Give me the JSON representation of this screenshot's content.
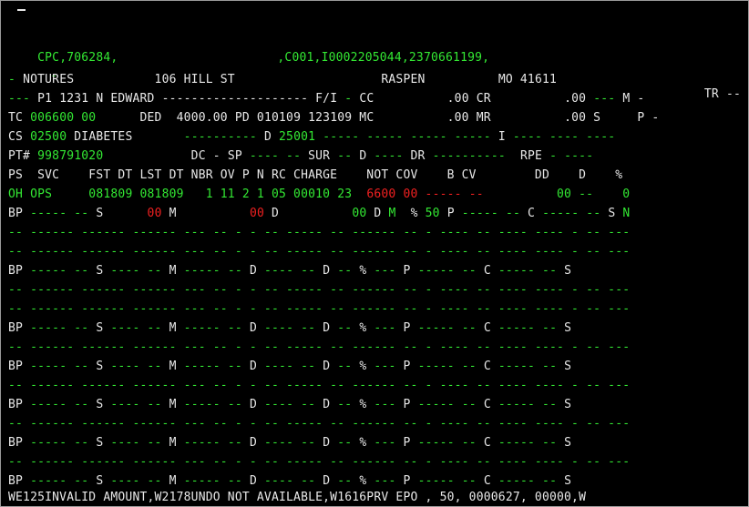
{
  "header": {
    "line1_left": "CPC,706284,",
    "line1_right": ",C001,I0002205044,2370661199,",
    "line2_dash": "-",
    "line2_tr": "TR --"
  },
  "patient": {
    "row1": [
      {
        "t": "- ",
        "c": "g"
      },
      {
        "t": "NOTURES",
        "c": "w"
      },
      {
        "t": "           106 HILL ST",
        "c": "w"
      },
      {
        "t": "                    RASPEN",
        "c": "w"
      },
      {
        "t": "          MO 41611",
        "c": "w"
      }
    ],
    "row2": [
      {
        "t": "--- ",
        "c": "g"
      },
      {
        "t": "P1 1231 N EDWARD ",
        "c": "w"
      },
      {
        "t": "-------------------- ",
        "c": "w"
      },
      {
        "t": "F/I",
        "c": "w"
      },
      {
        "t": " - ",
        "c": "g"
      },
      {
        "t": "CC",
        "c": "w"
      },
      {
        "t": "          .00 CR",
        "c": "w"
      },
      {
        "t": "          .00 ",
        "c": "w"
      },
      {
        "t": "--- ",
        "c": "g"
      },
      {
        "t": "M -",
        "c": "w"
      }
    ],
    "row3": [
      {
        "t": "TC ",
        "c": "w"
      },
      {
        "t": "006600 00",
        "c": "g"
      },
      {
        "t": "      DED  4000.00 PD 010109 123109 MC",
        "c": "w"
      },
      {
        "t": "          .00 MR",
        "c": "w"
      },
      {
        "t": "          .00 S     P -",
        "c": "w"
      }
    ],
    "row4": [
      {
        "t": "CS ",
        "c": "w"
      },
      {
        "t": "02500",
        "c": "g"
      },
      {
        "t": " DIABETES",
        "c": "w"
      },
      {
        "t": "       ---------- ",
        "c": "g"
      },
      {
        "t": "D ",
        "c": "w"
      },
      {
        "t": "25001",
        "c": "g"
      },
      {
        "t": " ----- ----- ----- ----- ",
        "c": "g"
      },
      {
        "t": "I",
        "c": "w"
      },
      {
        "t": " ---- ---- ----",
        "c": "g"
      }
    ],
    "row5": [
      {
        "t": "PT# ",
        "c": "w"
      },
      {
        "t": "998791020",
        "c": "g"
      },
      {
        "t": "            DC - SP ",
        "c": "w"
      },
      {
        "t": "---- -- ",
        "c": "g"
      },
      {
        "t": "SUR",
        "c": "w"
      },
      {
        "t": " -- ",
        "c": "g"
      },
      {
        "t": "D",
        "c": "w"
      },
      {
        "t": " ---- ",
        "c": "g"
      },
      {
        "t": "DR",
        "c": "w"
      },
      {
        "t": " ----------  ",
        "c": "g"
      },
      {
        "t": "RPE",
        "c": "w"
      },
      {
        "t": " - ----",
        "c": "g"
      }
    ]
  },
  "columns": {
    "header_row": "PS  SVC    FST DT LST DT NBR OV P N RC CHARGE    NOT COV    B CV        DD    D    %",
    "first_line": [
      {
        "t": "OH OPS",
        "c": "g"
      },
      {
        "t": "     081809 081809   1 11 2 1 05 00010 23  ",
        "c": "g"
      },
      {
        "t": "6600 00",
        "c": "r"
      },
      {
        "t": " ----- --",
        "c": "r"
      },
      {
        "t": "          00 --    0",
        "c": "g"
      }
    ]
  },
  "bp_first": [
    {
      "t": "BP",
      "c": "w"
    },
    {
      "t": " ----- -- ",
      "c": "g"
    },
    {
      "t": "S",
      "c": "w"
    },
    {
      "t": "      ",
      "c": "g"
    },
    {
      "t": "00",
      "c": "r"
    },
    {
      "t": " M",
      "c": "w"
    },
    {
      "t": "          ",
      "c": "g"
    },
    {
      "t": "00",
      "c": "r"
    },
    {
      "t": " D",
      "c": "w"
    },
    {
      "t": "          00",
      "c": "g"
    },
    {
      "t": " D ",
      "c": "w"
    },
    {
      "t": "M",
      "c": "g"
    },
    {
      "t": "  % ",
      "c": "w"
    },
    {
      "t": "50",
      "c": "g"
    },
    {
      "t": " P",
      "c": "w"
    },
    {
      "t": " ----- -- ",
      "c": "g"
    },
    {
      "t": "C",
      "c": "w"
    },
    {
      "t": " ----- -- ",
      "c": "g"
    },
    {
      "t": "S ",
      "c": "w"
    },
    {
      "t": "N",
      "c": "g"
    }
  ],
  "dash_row": "-- ------ ------ ------ --- -- - - -- ----- -- ------ -- - ---- -- ---- ---- - -- ---",
  "bp_empty": [
    {
      "t": "BP",
      "c": "w"
    },
    {
      "t": " ----- -- ",
      "c": "g"
    },
    {
      "t": "S",
      "c": "w"
    },
    {
      "t": " ---- -- ",
      "c": "g"
    },
    {
      "t": "M",
      "c": "w"
    },
    {
      "t": " ----- -- ",
      "c": "g"
    },
    {
      "t": "D",
      "c": "w"
    },
    {
      "t": " ---- -- ",
      "c": "g"
    },
    {
      "t": "D",
      "c": "w"
    },
    {
      "t": " -- ",
      "c": "g"
    },
    {
      "t": "%",
      "c": "w"
    },
    {
      "t": " --- ",
      "c": "g"
    },
    {
      "t": "P",
      "c": "w"
    },
    {
      "t": " ----- -- ",
      "c": "g"
    },
    {
      "t": "C",
      "c": "w"
    },
    {
      "t": " ----- -- ",
      "c": "g"
    },
    {
      "t": "S",
      "c": "w"
    }
  ],
  "bp_last": [
    {
      "t": "BP",
      "c": "w"
    },
    {
      "t": " ----- -- ",
      "c": "g"
    },
    {
      "t": "S",
      "c": "w"
    },
    {
      "t": " ---- -- ",
      "c": "g"
    },
    {
      "t": "M",
      "c": "w"
    },
    {
      "t": " ----- -- ",
      "c": "g"
    },
    {
      "t": "D",
      "c": "w"
    },
    {
      "t": " ---- -- ",
      "c": "g"
    },
    {
      "t": "D",
      "c": "w"
    },
    {
      "t": " -- ",
      "c": "g"
    },
    {
      "t": "%",
      "c": "w"
    },
    {
      "t": " --- ",
      "c": "g"
    },
    {
      "t": "P",
      "c": "w"
    },
    {
      "t": " ----- -- ",
      "c": "g"
    },
    {
      "t": "C",
      "c": "w"
    },
    {
      "t": " ----- -- ",
      "c": "g"
    },
    {
      "t": "S",
      "c": "w"
    }
  ],
  "status_line": "WE125INVALID AMOUNT,W2178UNDO NOT AVAILABLE,W1616PRV EPO , 50, 0000627, 00000,W"
}
